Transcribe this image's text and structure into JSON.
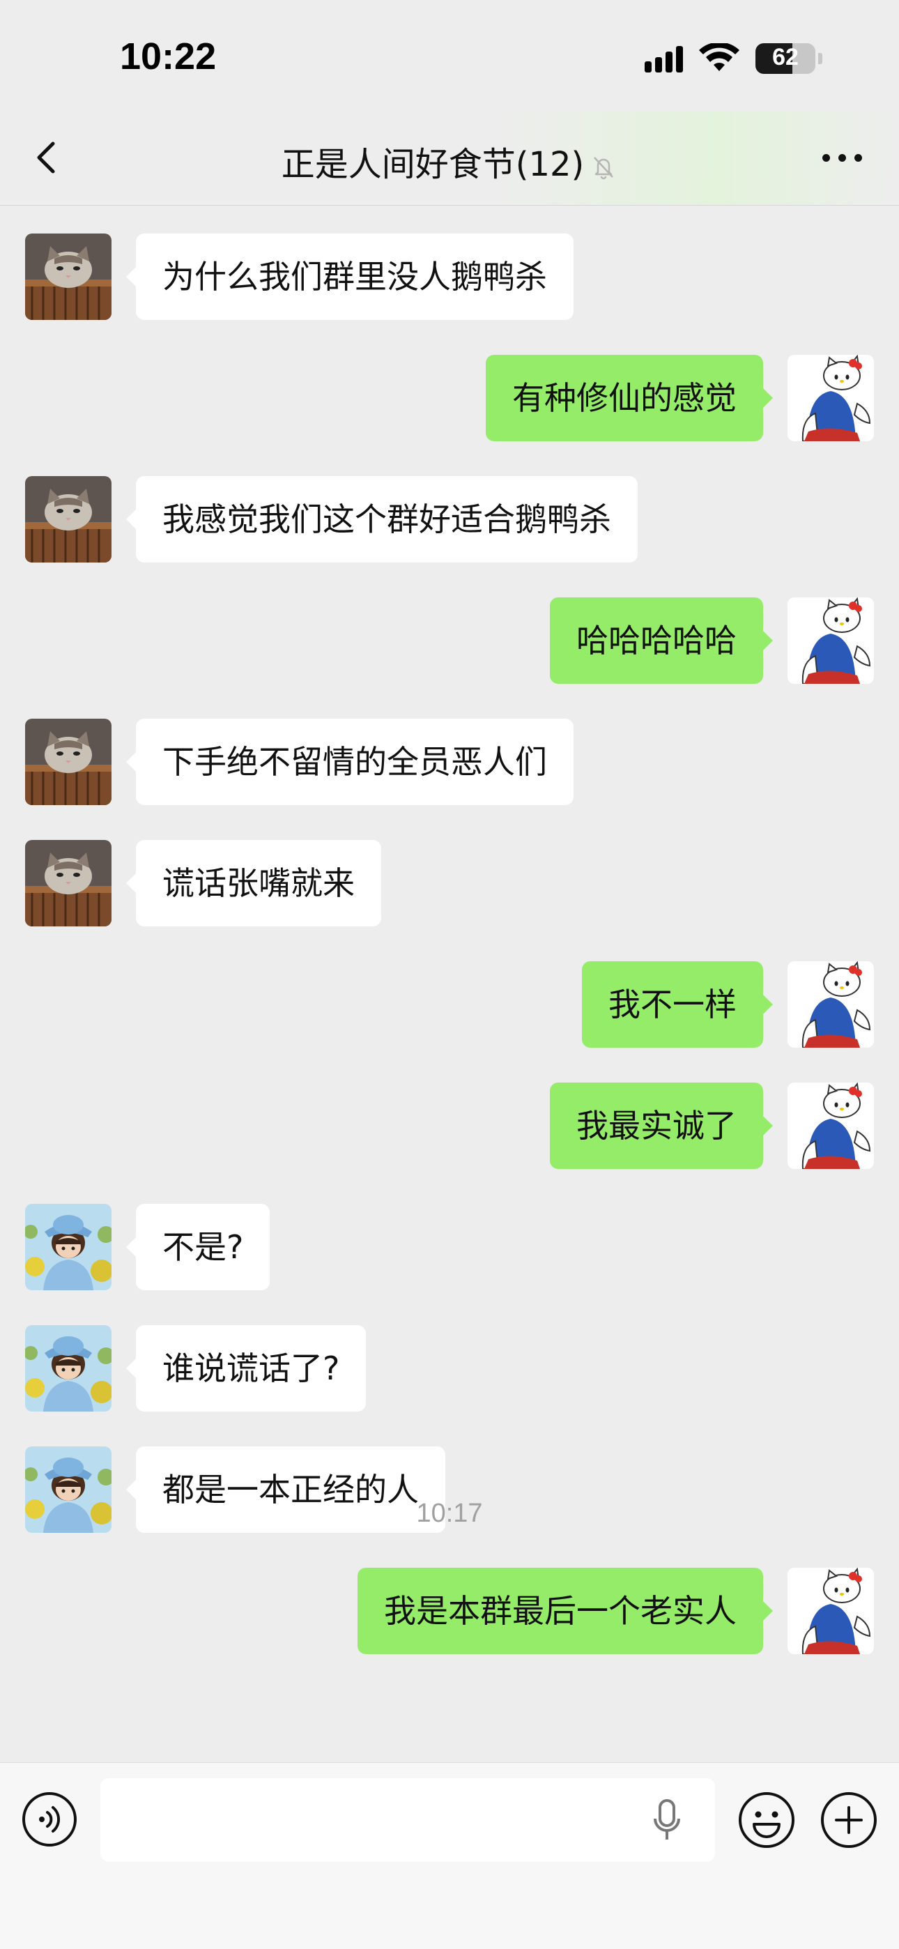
{
  "status_bar": {
    "time": "10:22",
    "battery": "62",
    "battery_level": 0.62
  },
  "nav": {
    "title": "正是人间好食节(12)"
  },
  "messages": [
    {
      "side": "left",
      "avatar": "cat-avatar",
      "text": "为什么我们群里没人鹅鸭杀"
    },
    {
      "side": "right",
      "avatar": "kitty-avatar",
      "text": "有种修仙的感觉"
    },
    {
      "side": "left",
      "avatar": "cat-avatar",
      "text": "我感觉我们这个群好适合鹅鸭杀"
    },
    {
      "side": "right",
      "avatar": "kitty-avatar",
      "text": "哈哈哈哈哈"
    },
    {
      "side": "left",
      "avatar": "cat-avatar",
      "text": "下手绝不留情的全员恶人们"
    },
    {
      "side": "left",
      "avatar": "cat-avatar",
      "text": "谎话张嘴就来"
    },
    {
      "side": "right",
      "avatar": "kitty-avatar",
      "text": "我不一样"
    },
    {
      "side": "right",
      "avatar": "kitty-avatar",
      "text": "我最实诚了"
    },
    {
      "side": "left",
      "avatar": "girl-avatar",
      "text": "不是?"
    },
    {
      "side": "left",
      "avatar": "girl-avatar",
      "text": "谁说谎话了?"
    },
    {
      "side": "left",
      "avatar": "girl-avatar",
      "text": "都是一本正经的人"
    },
    {
      "side": "right",
      "avatar": "kitty-avatar",
      "text": "我是本群最后一个老实人"
    }
  ],
  "timestamp": "10:17",
  "input_bar": {
    "value": ""
  },
  "icons": {
    "back": "chevron-left-icon",
    "mute": "bell-off-icon",
    "more": "more-dots-icon",
    "voice": "voice-icon",
    "mic": "microphone-icon",
    "emoji": "emoji-icon",
    "plus": "plus-icon"
  },
  "colors": {
    "sent_bubble": "#95ec69",
    "received_bubble": "#ffffff",
    "background": "#ededed"
  }
}
